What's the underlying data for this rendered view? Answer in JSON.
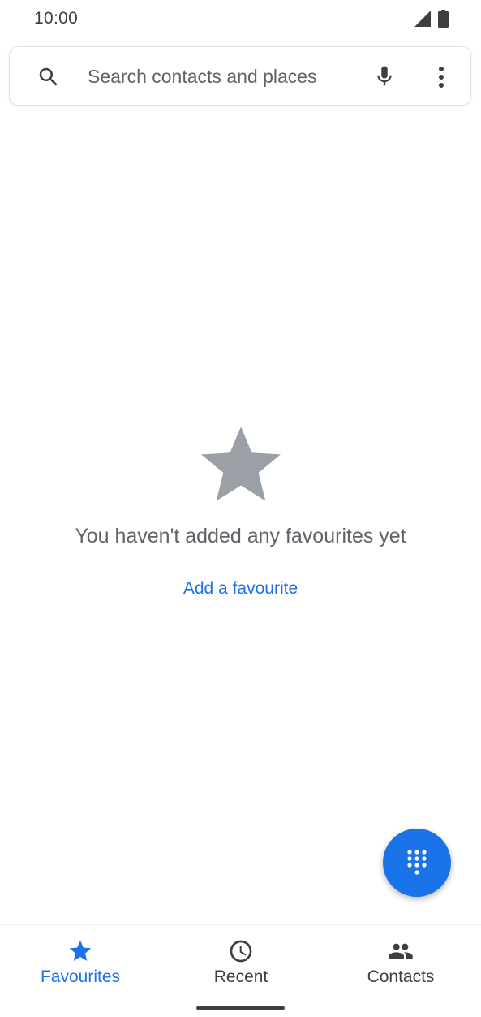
{
  "status_bar": {
    "time": "10:00",
    "icons": [
      "signal-icon",
      "battery-icon"
    ]
  },
  "search": {
    "placeholder": "Search contacts and places",
    "value": "",
    "icons": [
      "search-icon",
      "mic-icon",
      "more-vert-icon"
    ]
  },
  "empty_state": {
    "icon": "star-icon",
    "message": "You haven't added any favourites yet",
    "action_label": "Add a favourite"
  },
  "fab": {
    "icon": "dialpad-icon"
  },
  "bottom_nav": {
    "tabs": [
      {
        "label": "Favourites",
        "icon": "star-icon",
        "selected": true
      },
      {
        "label": "Recent",
        "icon": "clock-icon",
        "selected": false
      },
      {
        "label": "Contacts",
        "icon": "people-icon",
        "selected": false
      }
    ]
  },
  "colors": {
    "accent": "#1a73e8",
    "text_secondary": "#5f6368",
    "text_primary": "#3c4043",
    "empty_star": "#9aa0a6"
  }
}
